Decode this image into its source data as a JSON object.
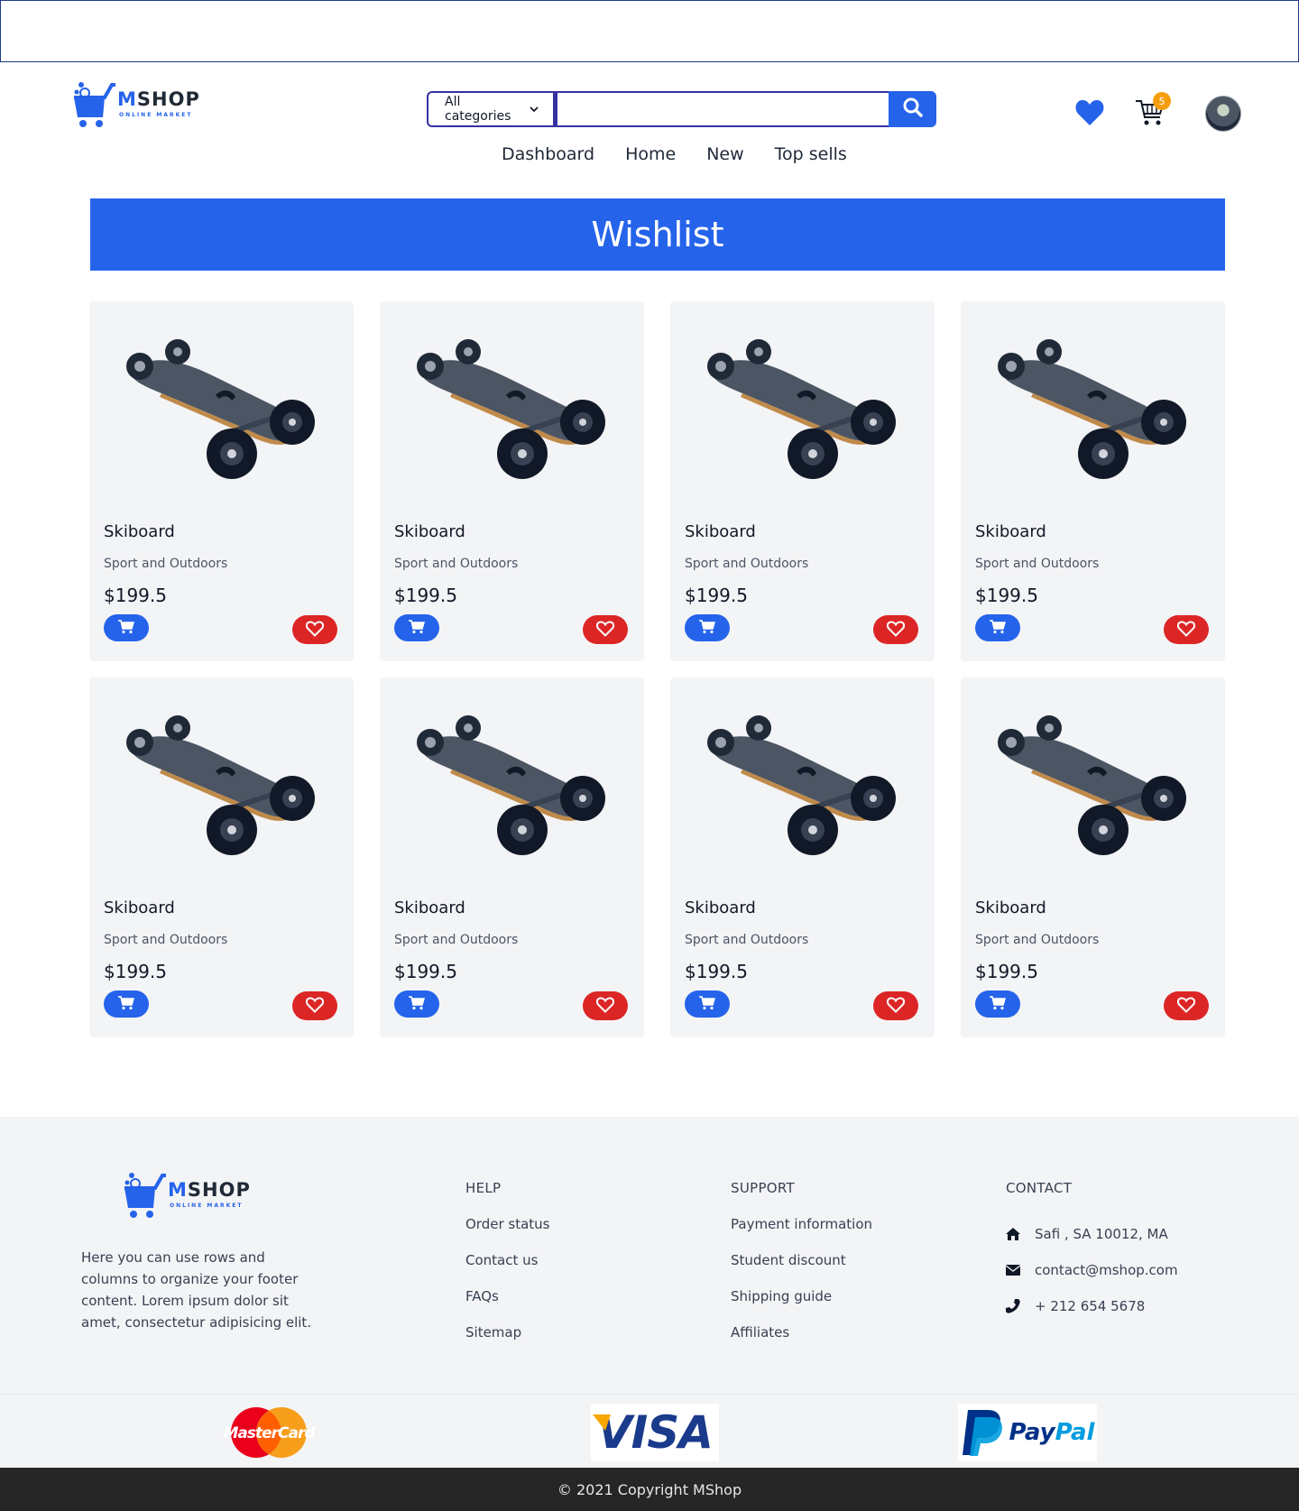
{
  "header": {
    "logo": {
      "brand": "MSHOP",
      "brand_accent": "M",
      "brand_rest": "SHOP",
      "tagline": "ONLINE MARKET"
    },
    "search": {
      "category": "All categories",
      "query": "",
      "placeholder": ""
    },
    "cart_count": "5",
    "nav": [
      "Dashboard",
      "Home",
      "New",
      "Top sells"
    ]
  },
  "page_title": "Wishlist",
  "products": [
    {
      "name": "Skiboard",
      "category": "Sport and Outdoors",
      "price": "$199.5"
    },
    {
      "name": "Skiboard",
      "category": "Sport and Outdoors",
      "price": "$199.5"
    },
    {
      "name": "Skiboard",
      "category": "Sport and Outdoors",
      "price": "$199.5"
    },
    {
      "name": "Skiboard",
      "category": "Sport and Outdoors",
      "price": "$199.5"
    },
    {
      "name": "Skiboard",
      "category": "Sport and Outdoors",
      "price": "$199.5"
    },
    {
      "name": "Skiboard",
      "category": "Sport and Outdoors",
      "price": "$199.5"
    },
    {
      "name": "Skiboard",
      "category": "Sport and Outdoors",
      "price": "$199.5"
    },
    {
      "name": "Skiboard",
      "category": "Sport and Outdoors",
      "price": "$199.5"
    }
  ],
  "footer": {
    "about": "Here you can use rows and columns to organize your footer content. Lorem ipsum dolor sit amet, consectetur adipisicing elit.",
    "help": {
      "title": "HELP",
      "links": [
        "Order status",
        "Contact us",
        "FAQs",
        "Sitemap"
      ]
    },
    "support": {
      "title": "SUPPORT",
      "links": [
        "Payment information",
        "Student discount",
        "Shipping guide",
        "Affiliates"
      ]
    },
    "contact": {
      "title": "CONTACT",
      "address": "Safi , SA 10012, MA",
      "email": "contact@mshop.com",
      "phone": "+ 212 654 5678"
    },
    "payments": {
      "mastercard": "MasterCard",
      "visa": "VISA",
      "paypal_pay": "Pay",
      "paypal_pal": "Pal"
    },
    "copyright": "© 2021 Copyright MShop"
  },
  "colors": {
    "primary": "#2563eb",
    "danger": "#dc2626",
    "badge": "#f59e0b",
    "card_bg": "#f3f4f6",
    "copyright_bg": "#262626"
  },
  "icons": [
    "cart-logo-icon",
    "search-icon",
    "chevron-down-icon",
    "heart-icon",
    "cart-icon",
    "home-icon",
    "envelope-icon",
    "phone-icon"
  ]
}
